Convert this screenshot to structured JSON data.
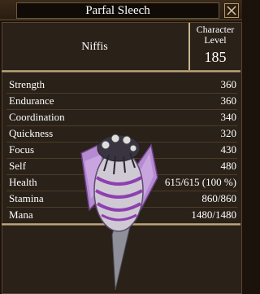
{
  "window": {
    "title": "Parfal Sleech"
  },
  "character": {
    "name": "Niffis",
    "level_label": "Character Level",
    "level_value": "185"
  },
  "stats": [
    {
      "label": "Strength",
      "value": "360"
    },
    {
      "label": "Endurance",
      "value": "360"
    },
    {
      "label": "Coordination",
      "value": "340"
    },
    {
      "label": "Quickness",
      "value": "320"
    },
    {
      "label": "Focus",
      "value": "430"
    },
    {
      "label": "Self",
      "value": "480"
    },
    {
      "label": "Health",
      "value": "615/615 (100 %)"
    },
    {
      "label": "Stamina",
      "value": "860/860"
    },
    {
      "label": "Mana",
      "value": "1480/1480"
    }
  ],
  "icons": {
    "close": "close-icon",
    "creature": "creature-portrait"
  },
  "colors": {
    "panel": "#2a2119",
    "border": "#c9b68d",
    "text": "#ffffff"
  }
}
